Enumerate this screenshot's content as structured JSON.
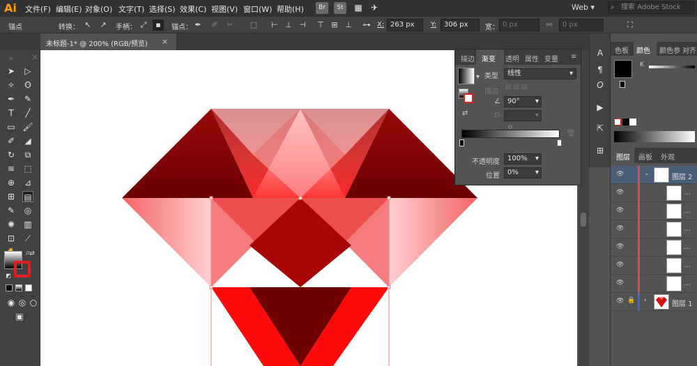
{
  "menubar": {
    "logo": "Ai",
    "items": [
      "文件(F)",
      "编辑(E)",
      "对象(O)",
      "文字(T)",
      "选择(S)",
      "效果(C)",
      "视图(V)",
      "窗口(W)",
      "帮助(H)"
    ],
    "bridge_label": "Br",
    "stock_label": "St",
    "workspace": "Web",
    "stock_search_placeholder": "搜索 Adobe Stock"
  },
  "controlbar": {
    "selection_label": "锚点",
    "convert_label": "转换：",
    "handles_label": "手柄：",
    "anchor_label": "锚点：",
    "x_label": "X:",
    "x_value": "263 px",
    "y_label": "Y:",
    "y_value": "306 px",
    "width_label": "宽：",
    "width_value": "0 px",
    "height_value": "0 px"
  },
  "document": {
    "tab_title": "未标题-1* @ 200% (RGB/预览)",
    "close_glyph": "×"
  },
  "gradient_panel": {
    "tabs": [
      "描边",
      "渐变",
      "透明",
      "属性",
      "变量"
    ],
    "active_tab": "渐变",
    "type_label": "类型",
    "type_value": "线性",
    "stroke_label": "描边",
    "angle_value": "90°",
    "opacity_label": "不透明度",
    "opacity_value": "100%",
    "position_label": "位置",
    "position_value": "0%"
  },
  "color_panel": {
    "tabs": [
      "色板",
      "颜色",
      "颜色参",
      "对齐"
    ],
    "active_tab": "颜色",
    "k_label": "K"
  },
  "layers_panel": {
    "tabs": [
      "图层",
      "画板",
      "外观"
    ],
    "active_tab": "图层",
    "layers": [
      {
        "name": "图层 2",
        "selected": true,
        "expanded": true
      },
      {
        "name": "...",
        "selected": false
      },
      {
        "name": "...",
        "selected": false
      },
      {
        "name": "...",
        "selected": false
      },
      {
        "name": "...",
        "selected": false
      },
      {
        "name": "...",
        "selected": false
      },
      {
        "name": "...",
        "selected": false
      },
      {
        "name": "图层 1",
        "selected": false,
        "locked": true
      }
    ]
  },
  "colors": {
    "ruby_dark": "#7a0000",
    "ruby_mid": "#cf0d0d",
    "ruby_light": "#ff4a4a",
    "ruby_pink": "#f57070",
    "ruby_bright": "#ff0a0a",
    "selection_blue": "#4b5e78",
    "layer_red": "#e0494a"
  }
}
